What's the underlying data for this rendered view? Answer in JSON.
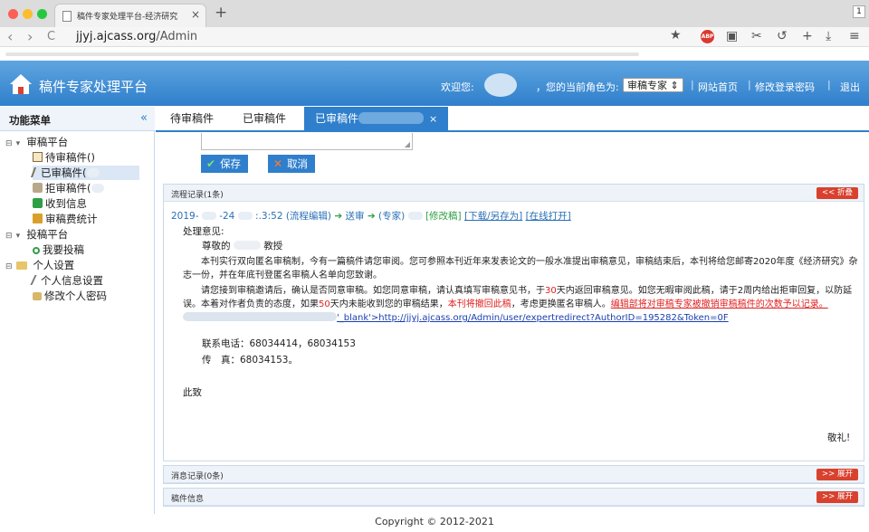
{
  "browser": {
    "tab_title": "稿件专家处理平台-经济研究",
    "tab_close": "×",
    "new_tab": "+",
    "tab_right": "1",
    "address_host": "jjyj.ajcass.org",
    "address_path": "/Admin",
    "back": "‹",
    "forward": "›",
    "reload": "C",
    "star": "★",
    "abp": "ABP",
    "tools": [
      "▣",
      "✂",
      "↺",
      "+",
      "⤓",
      "≡"
    ]
  },
  "header": {
    "title": "稿件专家处理平台",
    "welcome": "欢迎您:",
    "role_label": "，您的当前角色为:",
    "role_value": "审稿专家",
    "role_arrows": "⇕",
    "links": [
      "网站首页",
      "修改登录密码",
      "退出"
    ],
    "separator": "|"
  },
  "sidebar": {
    "title": "功能菜单",
    "collapse": "«",
    "groups": [
      {
        "label": "审稿平台",
        "items": [
          "待审稿件(",
          "已审稿件(",
          "拒审稿件(",
          "收到信息",
          "审稿费统计"
        ]
      },
      {
        "label": "投稿平台",
        "items": [
          "我要投稿"
        ]
      },
      {
        "label": "个人设置",
        "items": [
          "个人信息设置",
          "修改个人密码"
        ]
      }
    ],
    "toggle": "⊟",
    "toggle_open": "▾",
    "close_paren": ")",
    "bullet": "·"
  },
  "tabs": {
    "items": [
      "待审稿件",
      "已审稿件",
      "已审稿件"
    ],
    "close": "×"
  },
  "actions": {
    "save": "保存",
    "cancel": "取消",
    "save_icon": "✔",
    "cancel_icon": "✕",
    "grip": "◢"
  },
  "flow_panel": {
    "title": "流程记录(1条)",
    "button": "<< 折叠",
    "line_date": "2019-",
    "line_mid": "-24",
    "line_time": ":.3:52 (流程编辑)",
    "arrow": "➔",
    "line_send": "送审",
    "line_expert": "(专家)",
    "link_edit": "[修改稿]",
    "link_download": "[下载/另存为]",
    "link_online": "[在线打开]",
    "opinion_label": "处理意见:",
    "greeting_prefix": "尊敬的",
    "greeting_suffix": "教授",
    "para1": "本刊实行双向匿名审稿制，今有一篇稿件请您审阅。您可参照本刊近年来发表论文的一般水准提出审稿意见，审稿结束后，本刊将给您邮寄2020年度《经济研究》杂志一份，并在年底刊登匿名审稿人名单向您致谢。",
    "para2_a": "请您接到审稿邀请后，确认是否同意审稿。如您同意审稿，请认真填写审稿意见书，于",
    "para2_b": "30",
    "para2_c": "天内返回审稿意见。如您无暇审阅此稿，请于2周内给出拒审回复，以防延误。本着对作者负责的态度，如果",
    "para2_d": "50",
    "para2_e": "天内未能收到您的审稿结果，",
    "para2_f": "本刊将撤回此稿",
    "para2_g": "，考虑更换匿名审稿人。",
    "para2_h": "编辑部将对审稿专家被撤销审稿稿件的次数予以记录。",
    "para2_i": "'_blank'>http://jjyj.ajcass.org/Admin/user/expertredirect?AuthorID=195282&Token=0F",
    "phone": "联系电话：68034414，68034153",
    "fax": "传　真：68034153。",
    "closing": "此致",
    "regards": "敬礼!"
  },
  "msg_panel": {
    "title": "消息记录(0条)",
    "button": ">> 展开"
  },
  "info_panel": {
    "title": "稿件信息",
    "button": ">> 展开"
  },
  "footer": {
    "copyright": "Copyright © 2012-2021"
  }
}
